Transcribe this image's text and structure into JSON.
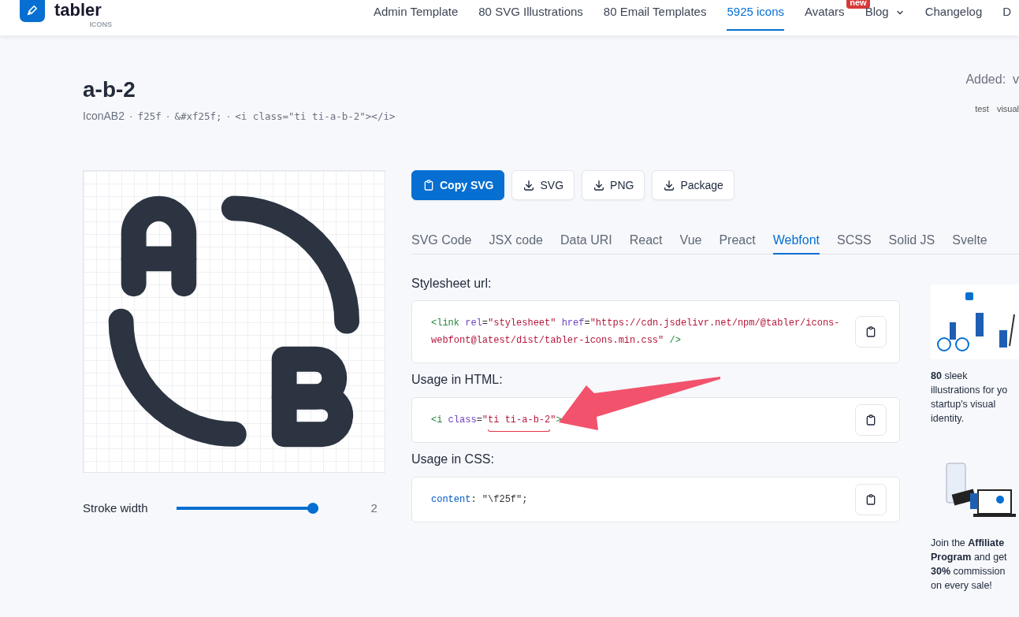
{
  "header": {
    "logo_text": "tabler",
    "logo_sub": "ICONS",
    "nav": [
      {
        "label": "Admin Template",
        "selected": false
      },
      {
        "label": "80 SVG Illustrations",
        "selected": false
      },
      {
        "label": "80 Email Templates",
        "selected": false
      },
      {
        "label": "5925 icons",
        "selected": true
      },
      {
        "label": "Avatars",
        "selected": false,
        "badge": "new"
      },
      {
        "label": "Blog",
        "selected": false,
        "dropdown": true
      },
      {
        "label": "Changelog",
        "selected": false
      },
      {
        "label": "D",
        "selected": false
      }
    ]
  },
  "icon": {
    "title": "a-b-2",
    "meta": [
      {
        "kind": "text",
        "text": "IconAB2"
      },
      {
        "kind": "sep",
        "text": "·"
      },
      {
        "kind": "code",
        "text": "f25f"
      },
      {
        "kind": "sep",
        "text": "·"
      },
      {
        "kind": "code",
        "text": "&#xf25f;"
      },
      {
        "kind": "sep",
        "text": "·"
      },
      {
        "kind": "code",
        "text": "<i class=\"ti ti-a-b-2\"></i>"
      }
    ],
    "added": "Added:  v",
    "tags": [
      "test",
      "visual"
    ]
  },
  "stroke": {
    "label": "Stroke width",
    "level": 1,
    "reading": "2"
  },
  "actions": [
    {
      "kind": "primary",
      "label": "Copy SVG"
    },
    {
      "kind": "download",
      "label": "SVG"
    },
    {
      "kind": "download",
      "label": "PNG"
    },
    {
      "kind": "download",
      "label": "Package"
    }
  ],
  "tabs": [
    {
      "label": "SVG Code",
      "selected": false
    },
    {
      "label": "JSX code",
      "selected": false
    },
    {
      "label": "Data URI",
      "selected": false
    },
    {
      "label": "React",
      "selected": false
    },
    {
      "label": "Vue",
      "selected": false
    },
    {
      "label": "Preact",
      "selected": false
    },
    {
      "label": "Webfont",
      "selected": true
    },
    {
      "label": "SCSS",
      "selected": false
    },
    {
      "label": "Solid JS",
      "selected": false
    },
    {
      "label": "Svelte",
      "selected": false
    }
  ],
  "snippets": [
    {
      "label": "Stylesheet url:",
      "tokens": [
        {
          "kind": "tag",
          "text": "<link"
        },
        {
          "kind": "attr",
          "text": " rel"
        },
        {
          "kind": "plain",
          "text": "="
        },
        {
          "kind": "string",
          "text": "\"stylesheet\""
        },
        {
          "kind": "attr",
          "text": " href"
        },
        {
          "kind": "plain",
          "text": "="
        },
        {
          "kind": "string",
          "text": "\"https://cdn.jsdelivr.net/npm/@tabler/icons-webfont@latest/dist/tabler-icons.min.css\""
        },
        {
          "kind": "tag",
          "text": " />"
        }
      ],
      "annotated": false
    },
    {
      "label": "Usage in HTML:",
      "tokens": [
        {
          "kind": "tag",
          "text": "<i"
        },
        {
          "kind": "attr",
          "text": " class"
        },
        {
          "kind": "plain",
          "text": "="
        },
        {
          "kind": "string",
          "text": "\"ti ti-a-b-2\""
        },
        {
          "kind": "tag",
          "text": ">"
        }
      ],
      "annotated": true
    },
    {
      "label": "Usage in CSS:",
      "tokens": [
        {
          "kind": "prop",
          "text": "content"
        },
        {
          "kind": "plain",
          "text": ": "
        },
        {
          "kind": "plain",
          "text": "\"\\f25f\";"
        }
      ],
      "annotated": false
    }
  ],
  "promos": [
    {
      "lines": [
        "**80** sleek",
        "illustrations for yo",
        "startup's visual",
        "identity."
      ]
    },
    {
      "lines": [
        "Join the **Affiliate**",
        "**Program** and get",
        "**30%** commission",
        "on every sale!"
      ]
    }
  ]
}
